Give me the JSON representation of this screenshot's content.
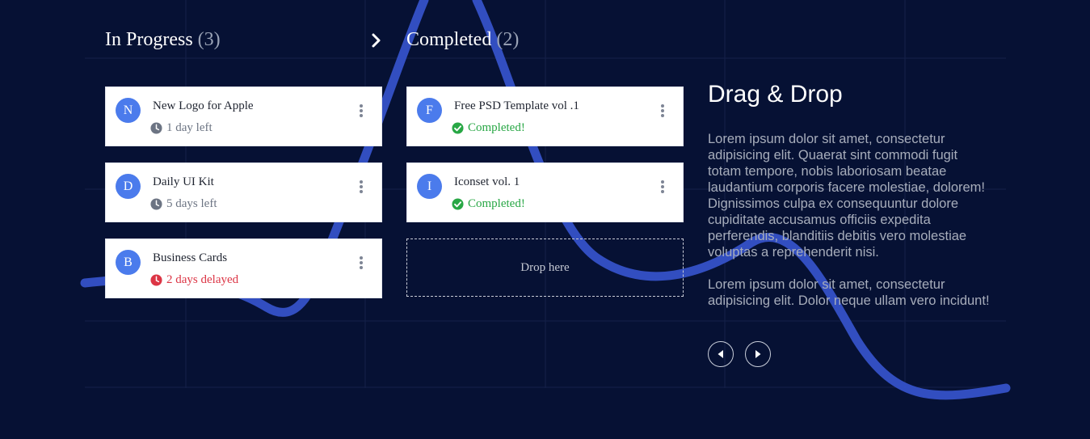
{
  "columns": {
    "in_progress": {
      "title": "In Progress",
      "count": "(3)"
    },
    "completed": {
      "title": "Completed",
      "count": "(2)"
    }
  },
  "in_progress_cards": [
    {
      "initial": "N",
      "title": "New Logo for Apple",
      "status": "1 day left",
      "status_icon": "clock-icon"
    },
    {
      "initial": "D",
      "title": "Daily UI Kit",
      "status": "5 days left",
      "status_icon": "clock-icon"
    },
    {
      "initial": "B",
      "title": "Business Cards",
      "status": "2 days delayed",
      "status_icon": "clock-icon"
    }
  ],
  "completed_cards": [
    {
      "initial": "F",
      "title": "Free PSD Template vol .1",
      "status": "Completed!",
      "status_icon": "check-circle-icon"
    },
    {
      "initial": "I",
      "title": "Iconset vol. 1",
      "status": "Completed!",
      "status_icon": "check-circle-icon"
    }
  ],
  "dropzone": {
    "label": "Drop here"
  },
  "side": {
    "title": "Drag & Drop",
    "paragraph1": "Lorem ipsum dolor sit amet, consectetur adipisicing elit. Quaerat sint commodi fugit totam tempore, nobis laboriosam beatae laudantium corporis facere molestiae, dolorem! Dignissimos culpa ex consequuntur dolore cupiditate accusamus officiis expedita perferendis, blanditiis debitis vero molestiae voluptas a reprehenderit nisi.",
    "paragraph2": "Lorem ipsum dolor sit amet, consectetur adipisicing elit. Dolor neque ullam vero incidunt!"
  },
  "icons": {
    "arrow": "chevron-right-icon",
    "prev": "triangle-left-icon",
    "next": "triangle-right-icon",
    "menu": "kebab-menu-icon"
  },
  "colors": {
    "background": "#061134",
    "accent_wave": "#3552c8",
    "avatar": "#4b7bec",
    "success": "#28a745",
    "danger": "#dc3545",
    "neutral": "#6c7483"
  }
}
